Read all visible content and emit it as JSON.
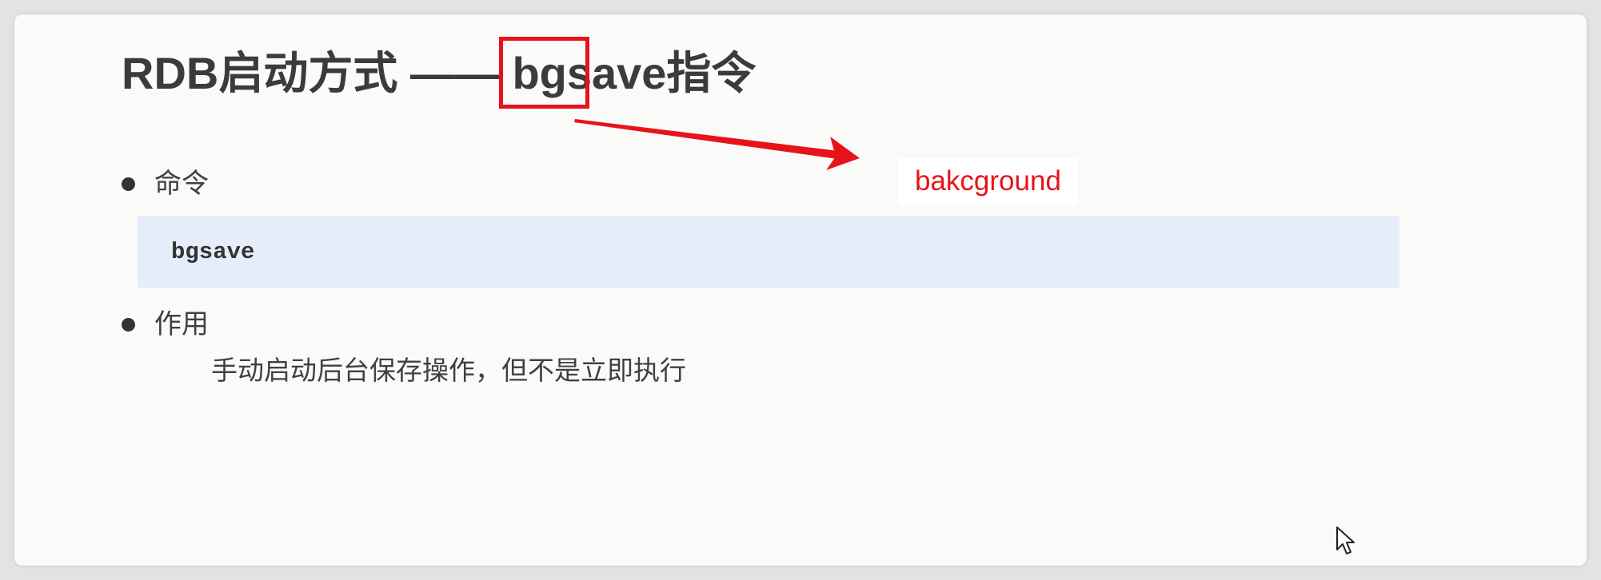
{
  "slide": {
    "title": "RDB启动方式 —— bgsave指令",
    "annotation": {
      "label": "bakcground",
      "color": "#e8131a"
    },
    "sections": [
      {
        "heading": "命令",
        "code": "bgsave"
      },
      {
        "heading": "作用",
        "description": "手动启动后台保存操作，但不是立即执行"
      }
    ]
  },
  "colors": {
    "background": "#fafbf9",
    "code_background": "#e5edfb",
    "text": "#3b3b3b",
    "accent": "#e8131a"
  },
  "icons": {
    "bullet": "filled-circle-bullet-icon",
    "cursor": "mouse-pointer-icon"
  }
}
